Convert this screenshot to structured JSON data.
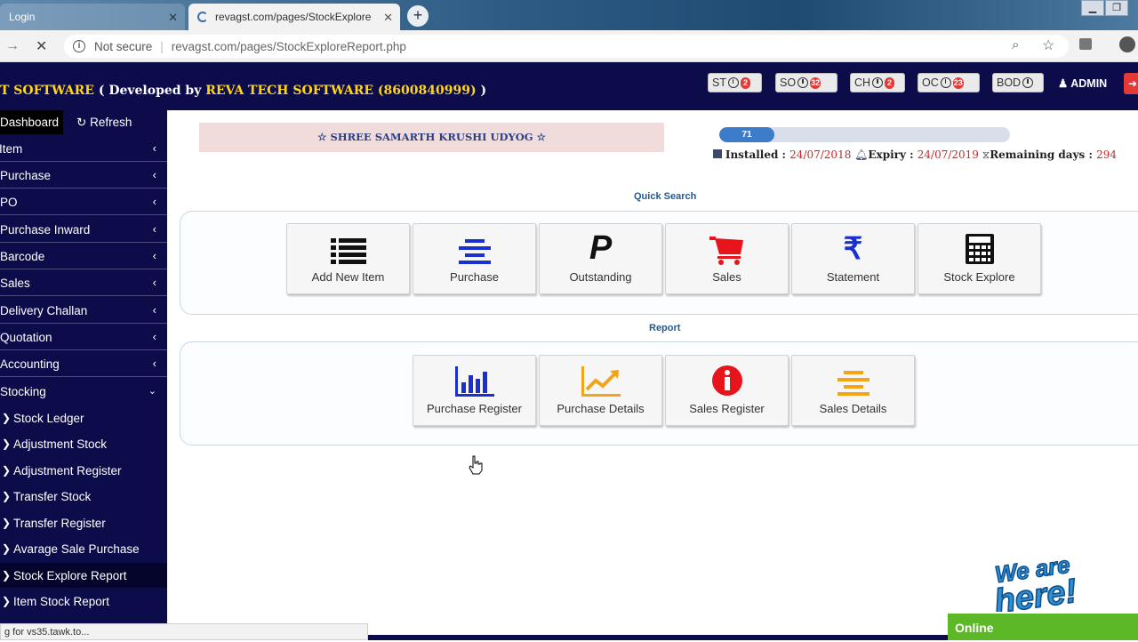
{
  "browser": {
    "tabs": [
      {
        "title": "Login",
        "active": false
      },
      {
        "title": "revagst.com/pages/StockExplore",
        "active": true
      }
    ],
    "security_label": "Not secure",
    "url": "revagst.com/pages/StockExploreReport.php",
    "status_text": "g for vs35.tawk.to..."
  },
  "header": {
    "title_prefix": "T SOFTWARE",
    "title_developed": " ( Developed by ",
    "title_company": "REVA TECH SOFTWARE (8600840999)",
    "title_suffix": " )",
    "badges": [
      {
        "label": "ST",
        "count": "2"
      },
      {
        "label": "SO",
        "count": "32"
      },
      {
        "label": "CH",
        "count": "2"
      },
      {
        "label": "OC",
        "count": "23"
      },
      {
        "label": "BOD",
        "count": ""
      }
    ],
    "user": "ADMIN"
  },
  "sidebar": {
    "top": {
      "dashboard": "Dashboard",
      "refresh": "Refresh"
    },
    "items": [
      "Item",
      "Purchase",
      "PO",
      "Purchase Inward",
      "Barcode",
      "Sales",
      "Delivery Challan",
      "Quotation",
      "Accounting",
      "Stocking"
    ],
    "stocking_sub": [
      "Stock Ledger",
      "Adjustment Stock",
      "Adjustment Register",
      "Transfer Stock",
      "Transfer Register",
      "Avarage Sale Purchase",
      "Stock Explore Report",
      "Item Stock Report"
    ],
    "selected": "Stock Explore Report"
  },
  "license": {
    "company": "SHREE SAMARTH KRUSHI UDYOG",
    "progress_value": "71",
    "progress_fraction": 0.19,
    "installed_label": "Installed : ",
    "installed": "24/07/2018",
    "expiry_label": "Expiry : ",
    "expiry": "24/07/2019",
    "remaining_label": "Remaining days : ",
    "remaining": "294"
  },
  "quick_search": {
    "title": "Quick Search",
    "buttons": [
      "Add New Item",
      "Purchase",
      "Outstanding",
      "Sales",
      "Statement",
      "Stock Explore"
    ]
  },
  "report": {
    "title": "Report",
    "buttons": [
      "Purchase Register",
      "Purchase Details",
      "Sales Register",
      "Sales Details"
    ]
  },
  "chat": {
    "status": "Online",
    "badge_text": "We are here!"
  },
  "colors": {
    "navy": "#0c0c4a",
    "accent_yellow": "#ffd51a",
    "online_green": "#5cb826"
  }
}
